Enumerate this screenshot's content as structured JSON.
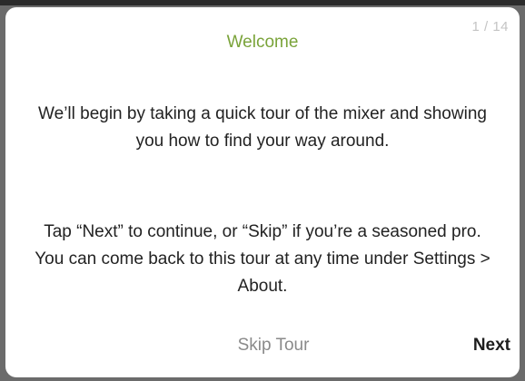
{
  "tour": {
    "page_counter": "1 / 14",
    "title": "Welcome",
    "paragraph_1": "We’ll begin by taking a quick tour of the mixer and showing you how to find your way around.",
    "paragraph_2": "Tap “Next” to continue, or “Skip” if you’re a seasoned pro. You can come back to this tour at any time under Settings > About.",
    "skip_label": "Skip Tour",
    "next_label": "Next"
  },
  "colors": {
    "title": "#7aa33a",
    "dialog_background": "#ffffff",
    "backdrop": "#6b6b6b"
  }
}
